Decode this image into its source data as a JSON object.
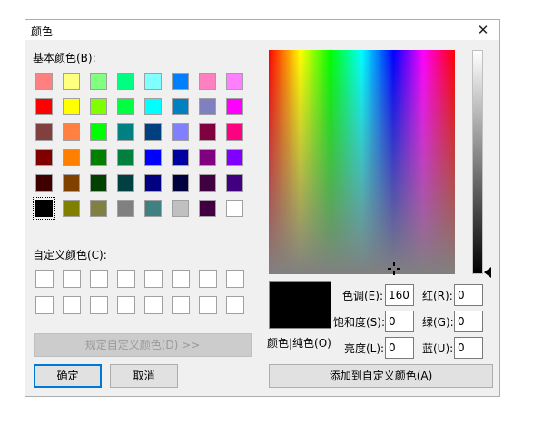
{
  "dialog": {
    "title": "颜色",
    "close_glyph": "✕",
    "basic_colors_label": "基本颜色(B):",
    "custom_colors_label": "自定义颜色(C):",
    "define_custom_button": "规定自定义颜色(D) >>",
    "ok_button": "确定",
    "cancel_button": "取消",
    "add_custom_button": "添加到自定义颜色(A)",
    "color_solid_label": "颜色|纯色(O)",
    "hue_label": "色调(E):",
    "hue_value": "160",
    "sat_label": "饱和度(S):",
    "sat_value": "0",
    "lum_label": "亮度(L):",
    "lum_value": "0",
    "red_label": "红(R):",
    "red_value": "0",
    "green_label": "绿(G):",
    "green_value": "0",
    "blue_label": "蓝(U):",
    "blue_value": "0",
    "selected_color": "#000000",
    "basic_colors": [
      [
        "#ff8080",
        "#ffff80",
        "#80ff80",
        "#00ff80",
        "#80ffff",
        "#0080ff",
        "#ff80c0",
        "#ff80ff"
      ],
      [
        "#ff0000",
        "#ffff00",
        "#80ff00",
        "#00ff40",
        "#00ffff",
        "#0080c0",
        "#8080c0",
        "#ff00ff"
      ],
      [
        "#804040",
        "#ff8040",
        "#00ff00",
        "#008080",
        "#004080",
        "#8080ff",
        "#800040",
        "#ff0080"
      ],
      [
        "#800000",
        "#ff8000",
        "#008000",
        "#008040",
        "#0000ff",
        "#0000a0",
        "#800080",
        "#8000ff"
      ],
      [
        "#400000",
        "#804000",
        "#004000",
        "#004040",
        "#000080",
        "#000040",
        "#400040",
        "#400080"
      ],
      [
        "#000000",
        "#808000",
        "#808040",
        "#808080",
        "#408080",
        "#c0c0c0",
        "#400040",
        "#ffffff"
      ]
    ],
    "custom_colors": [
      "#ffffff",
      "#ffffff",
      "#ffffff",
      "#ffffff",
      "#ffffff",
      "#ffffff",
      "#ffffff",
      "#ffffff",
      "#ffffff",
      "#ffffff",
      "#ffffff",
      "#ffffff",
      "#ffffff",
      "#ffffff",
      "#ffffff",
      "#ffffff"
    ]
  }
}
